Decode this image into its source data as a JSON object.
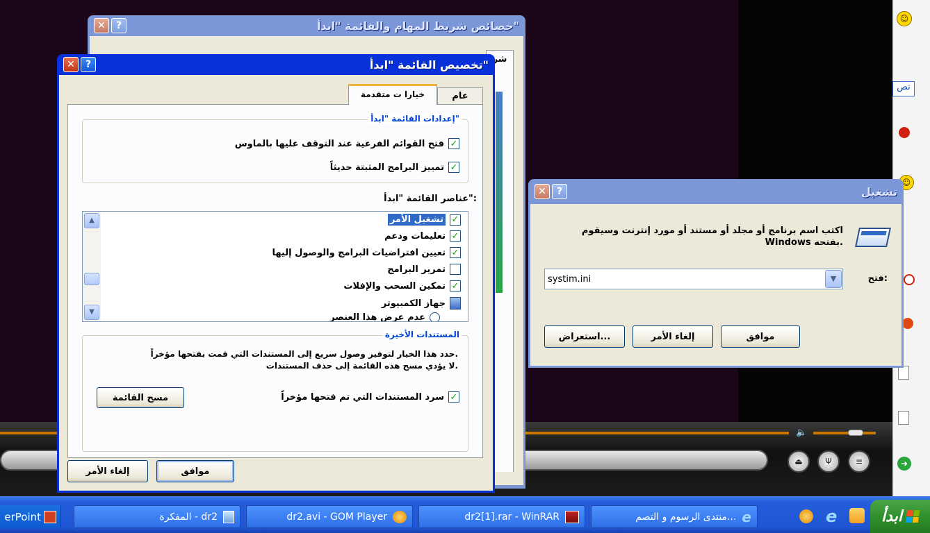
{
  "taskbar": {
    "start_label": "ابدأ",
    "items": [
      {
        "label": "منتدى الرسوم و التصم..."
      },
      {
        "label": "dr2[1].rar - WinRAR"
      },
      {
        "label": "dr2.avi - GOM Player"
      },
      {
        "label": "المفكرة - dr2"
      },
      {
        "label": "erPoint"
      }
    ]
  },
  "taskbar_props_window": {
    "title": "خصائص شريط المهام والقائمة \"ابدأ\"",
    "tab_partial": "شر"
  },
  "customize_start_menu": {
    "title": "تخصيص القائمة \"ابدأ\"",
    "tabs": [
      {
        "label": "عام"
      },
      {
        "label": "خيارا ت متقدمة"
      }
    ],
    "settings_group": {
      "label": "إعدادات القائمة \"ابدأ\"",
      "options": [
        {
          "label": "فتح القوائم الفرعية عند التوقف عليها بالماوس",
          "checked": true
        },
        {
          "label": "تمييز البرامج المثبتة حديثاً",
          "checked": true
        }
      ]
    },
    "items_label": "عناصر القائمة \"ابدأ\":",
    "items": [
      {
        "label": "تشغيل الأمر",
        "checked": true,
        "selected": true
      },
      {
        "label": "تعليمات ودعم",
        "checked": true
      },
      {
        "label": "تعيين افتراضيات البرامج والوصول إليها",
        "checked": true
      },
      {
        "label": "تمرير البرامج",
        "checked": false
      },
      {
        "label": "تمكين السحب والإفلات",
        "checked": true
      },
      {
        "label": "جهاز الكمبيوتر",
        "icon": "computer-icon"
      },
      {
        "label": "عدم عرض هذا العنصر",
        "radio": true
      }
    ],
    "recent_group": {
      "label": "المستندات الأخيرة",
      "description_1": "حدد هذا الخيار لتوفير وصول سريع إلى المستندات التي قمت بفتحها مؤخراً.",
      "description_2": "لا يؤدي مسح هذه القائمة إلى حذف المستندات.",
      "list_recent_label": "سرد المستندات التي تم فتحها مؤخراً",
      "list_recent_checked": true,
      "clear_button": "مسح القائمة"
    },
    "ok_button": "موافق",
    "cancel_button": "إلغاء الأمر"
  },
  "run_dialog": {
    "title": "تشغيل",
    "description": "اكتب اسم برنامج أو مجلد أو مستند أو مورد إنترنت وسيقوم Windows بفتحه.",
    "open_label": "فتح:",
    "open_value": "systim.ini",
    "ok_button": "موافق",
    "cancel_button": "إلغاء الأمر",
    "browse_button": "استعراض..."
  },
  "side_strip": {
    "text": "تص"
  }
}
